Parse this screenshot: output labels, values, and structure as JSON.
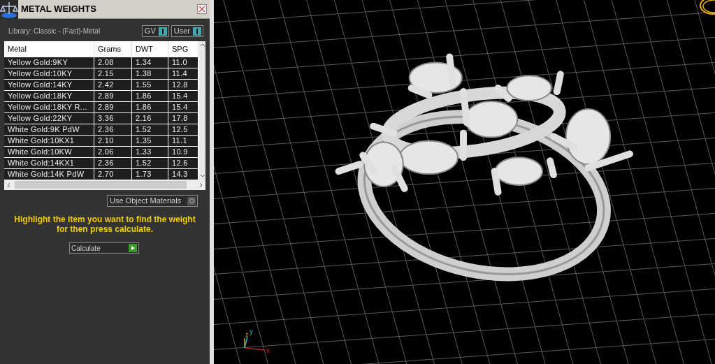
{
  "panel": {
    "title": "METAL WEIGHTS",
    "library": "Library: Classic - (Fast)-Metal",
    "toggles": [
      {
        "label": "GV",
        "on": true
      },
      {
        "label": "User",
        "on": true
      }
    ],
    "table": {
      "columns": [
        "Metal",
        "Grams",
        "DWT",
        "SPG"
      ],
      "rows": [
        [
          "Yellow Gold:9KY",
          "2.08",
          "1.34",
          "11.0"
        ],
        [
          "Yellow Gold:10KY",
          "2.15",
          "1.38",
          "11.4"
        ],
        [
          "Yellow Gold:14KY",
          "2.42",
          "1.55",
          "12.8"
        ],
        [
          "Yellow Gold:18KY",
          "2.89",
          "1.86",
          "15.4"
        ],
        [
          "Yellow Gold:18KY R...",
          "2.89",
          "1.86",
          "15.4"
        ],
        [
          "Yellow Gold:22KY",
          "3.36",
          "2.16",
          "17.8"
        ],
        [
          "White Gold:9K PdW",
          "2.36",
          "1.52",
          "12.5"
        ],
        [
          "White Gold:10KX1",
          "2.10",
          "1.35",
          "11.1"
        ],
        [
          "White Gold:10KW",
          "2.06",
          "1.33",
          "10.9"
        ],
        [
          "White Gold:14KX1",
          "2.36",
          "1.52",
          "12.6"
        ],
        [
          "White Gold:14K PdW",
          "2.70",
          "1.73",
          "14.3"
        ]
      ]
    },
    "use_object_materials": {
      "label": "Use Object Materials",
      "on": false
    },
    "hint": "Highlight the item you want to find the weight for then press calculate.",
    "calculate": "Calculate"
  },
  "viewport": {
    "axes": [
      "z",
      "y",
      "x"
    ]
  }
}
